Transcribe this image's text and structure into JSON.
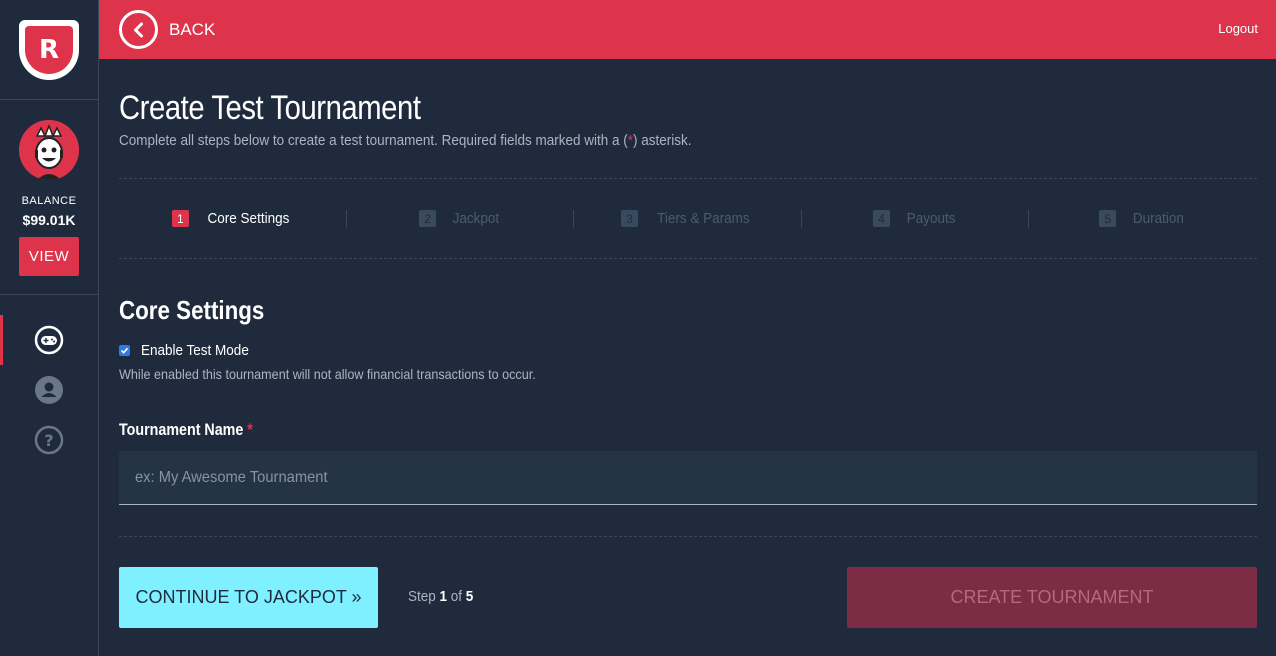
{
  "sidebar": {
    "logo_text": "R",
    "balance_label": "BALANCE",
    "balance_value": "$99.01K",
    "view_label": "VIEW",
    "nav": [
      {
        "icon": "gamepad-icon",
        "active": true
      },
      {
        "icon": "user-icon",
        "active": false
      },
      {
        "icon": "help-icon",
        "active": false
      }
    ]
  },
  "topbar": {
    "back_label": "BACK",
    "logout_label": "Logout"
  },
  "page": {
    "title": "Create Test Tournament",
    "subtitle_before": "Complete all steps below to create a test tournament. Required fields marked with a (",
    "subtitle_asterisk": "*",
    "subtitle_after": ") asterisk."
  },
  "steps": [
    {
      "num": "1",
      "label": "Core Settings",
      "active": true
    },
    {
      "num": "2",
      "label": "Jackpot",
      "active": false
    },
    {
      "num": "3",
      "label": "Tiers & Params",
      "active": false
    },
    {
      "num": "4",
      "label": "Payouts",
      "active": false
    },
    {
      "num": "5",
      "label": "Duration",
      "active": false
    }
  ],
  "core": {
    "section_title": "Core Settings",
    "test_mode_label": "Enable Test Mode",
    "test_mode_checked": true,
    "test_mode_help": "While enabled this tournament will not allow financial transactions to occur.",
    "name_label": "Tournament Name",
    "name_asterisk": "*",
    "name_placeholder": "ex: My Awesome Tournament"
  },
  "footer": {
    "continue_label": "CONTINUE TO JACKPOT »",
    "step_prefix": "Step",
    "step_current": "1",
    "step_of": "of",
    "step_total": "5",
    "create_label": "CREATE TOURNAMENT"
  },
  "colors": {
    "accent": "#dd344c",
    "background": "#1f2b3c",
    "continue": "#7ef0ff",
    "create_disabled": "#7c2c45",
    "checkbox": "#2f7ae5"
  }
}
